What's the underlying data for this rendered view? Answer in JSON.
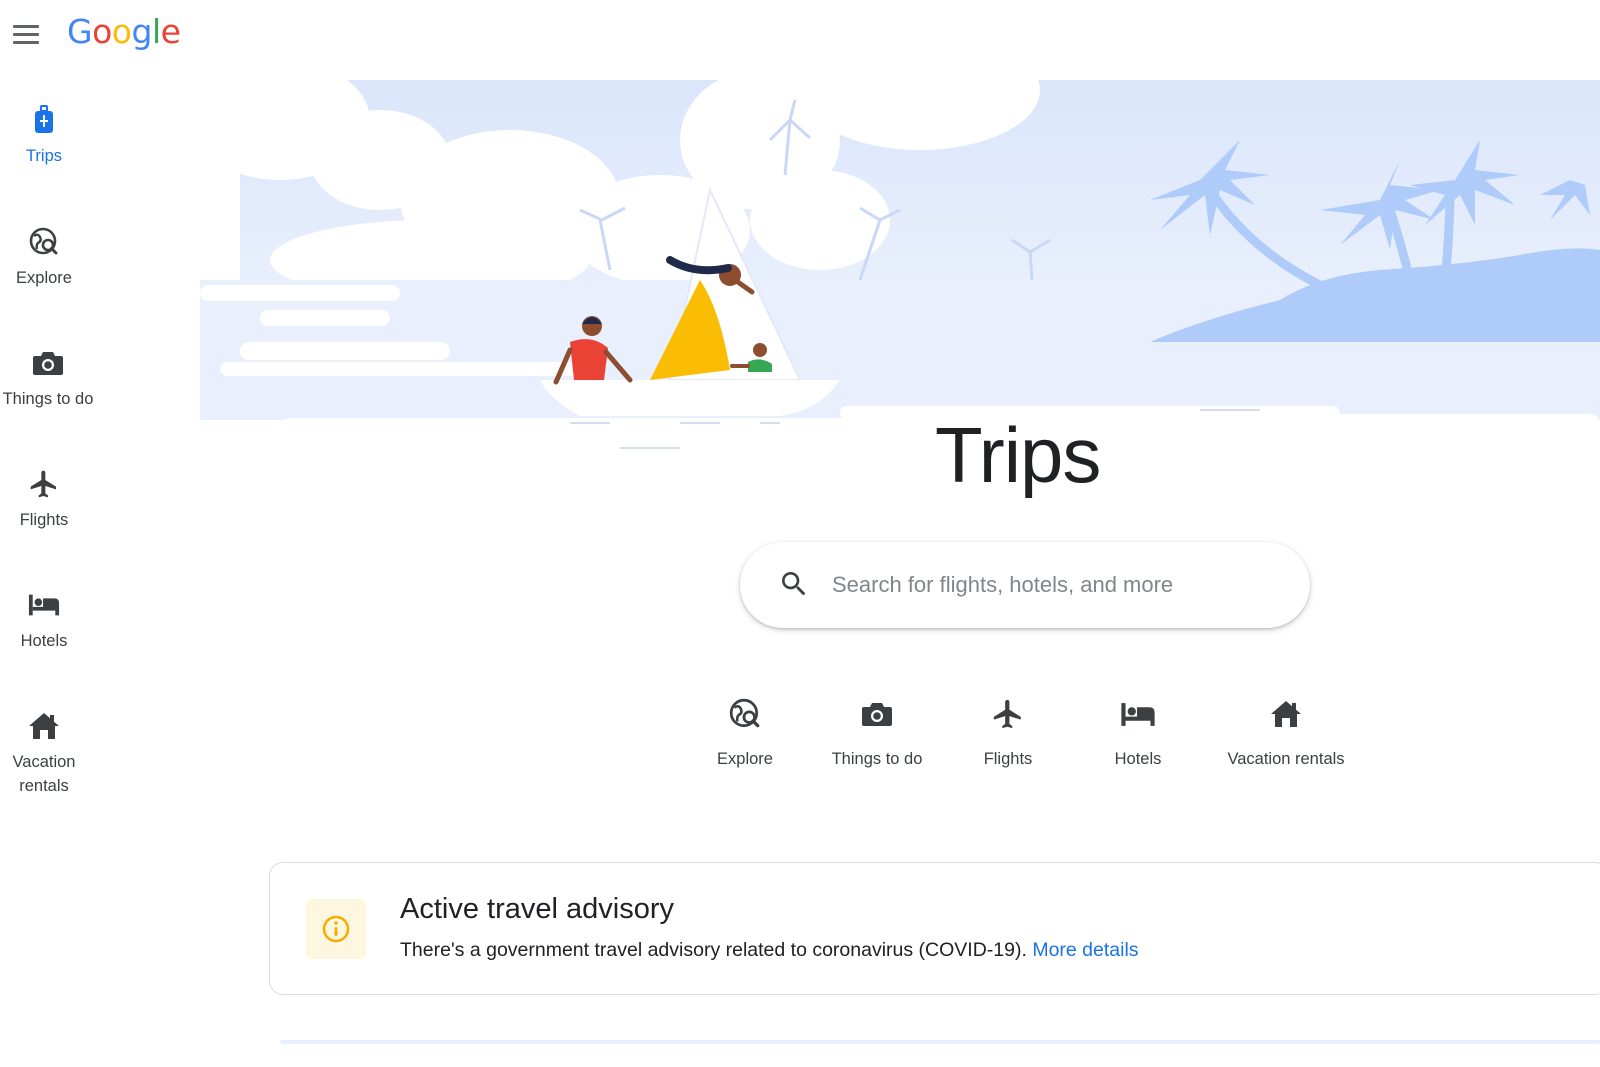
{
  "header": {
    "logo": [
      "G",
      "o",
      "o",
      "g",
      "l",
      "e"
    ],
    "logo_colors": [
      "#4285F4",
      "#EA4335",
      "#FBBC05",
      "#4285F4",
      "#34A853",
      "#EA4335"
    ]
  },
  "sidebar": {
    "items": [
      {
        "label": "Trips",
        "icon": "trips-luggage-icon",
        "active": true
      },
      {
        "label": "Explore",
        "icon": "explore-globe-icon"
      },
      {
        "label": "Things to do",
        "icon": "camera-icon"
      },
      {
        "label": "Flights",
        "icon": "airplane-icon"
      },
      {
        "label": "Hotels",
        "icon": "bed-icon"
      },
      {
        "label": "Vacation rentals",
        "icon": "house-icon"
      }
    ]
  },
  "main": {
    "title": "Trips",
    "search": {
      "placeholder": "Search for flights, hotels, and more"
    },
    "quick_links": [
      {
        "label": "Explore",
        "icon": "explore-globe-icon"
      },
      {
        "label": "Things to do",
        "icon": "camera-icon"
      },
      {
        "label": "Flights",
        "icon": "airplane-icon"
      },
      {
        "label": "Hotels",
        "icon": "bed-icon"
      },
      {
        "label": "Vacation rentals",
        "icon": "house-icon"
      }
    ],
    "advisory": {
      "title": "Active travel advisory",
      "body": "There's a government travel advisory related to coronavirus (COVID-19).",
      "link": "More details",
      "icon": "info-icon"
    }
  },
  "colors": {
    "accent": "#1a73e8",
    "hero_sky": "#e8f0fe",
    "hero_island": "#aecbfa",
    "advisory_icon": "#f9ab00"
  }
}
